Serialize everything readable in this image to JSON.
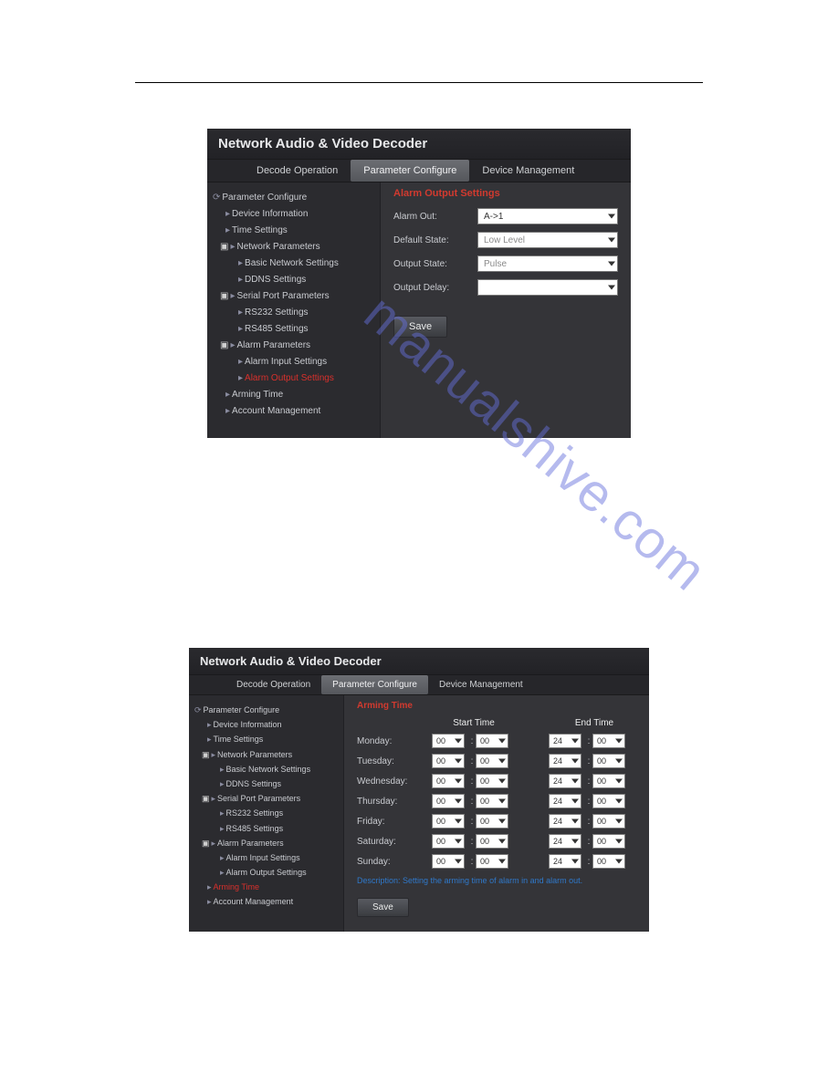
{
  "watermark": "manualshive.com",
  "app_title": "Network Audio & Video Decoder",
  "tabs": {
    "decode_operation": "Decode Operation",
    "parameter_configure": "Parameter Configure",
    "device_management": "Device Management"
  },
  "sidebar1": {
    "root": "Parameter Configure",
    "device_info": "Device Information",
    "time_settings": "Time Settings",
    "network_params": "Network Parameters",
    "basic_network": "Basic Network Settings",
    "ddns": "DDNS Settings",
    "serial_port": "Serial Port Parameters",
    "rs232": "RS232 Settings",
    "rs485": "RS485 Settings",
    "alarm_params": "Alarm Parameters",
    "alarm_input": "Alarm Input Settings",
    "alarm_output": "Alarm Output Settings",
    "arming_time": "Arming Time",
    "account": "Account Management"
  },
  "panel1": {
    "title": "Alarm Output Settings",
    "alarm_out_label": "Alarm Out:",
    "alarm_out_value": "A->1",
    "default_state_label": "Default State:",
    "default_state_value": "Low Level",
    "output_state_label": "Output State:",
    "output_state_value": "Pulse",
    "output_delay_label": "Output Delay:",
    "output_delay_value": "",
    "save": "Save"
  },
  "sidebar2": {
    "root": "Parameter Configure",
    "device_info": "Device Information",
    "time_settings": "Time Settings",
    "network_params": "Network Parameters",
    "basic_network": "Basic Network Settings",
    "ddns": "DDNS Settings",
    "serial_port": "Serial Port Parameters",
    "rs232": "RS232 Settings",
    "rs485": "RS485 Settings",
    "alarm_params": "Alarm Parameters",
    "alarm_input": "Alarm Input Settings",
    "alarm_output": "Alarm Output Settings",
    "arming_time": "Arming Time",
    "account": "Account Management"
  },
  "panel2": {
    "title": "Arming Time",
    "start_time": "Start Time",
    "end_time": "End Time",
    "days": {
      "monday": "Monday:",
      "tuesday": "Tuesday:",
      "wednesday": "Wednesday:",
      "thursday": "Thursday:",
      "friday": "Friday:",
      "saturday": "Saturday:",
      "sunday": "Sunday:"
    },
    "start_h": "00",
    "start_m": "00",
    "end_h": "24",
    "end_m": "00",
    "description": "Description: Setting the arming time of alarm in and alarm out.",
    "save": "Save"
  }
}
